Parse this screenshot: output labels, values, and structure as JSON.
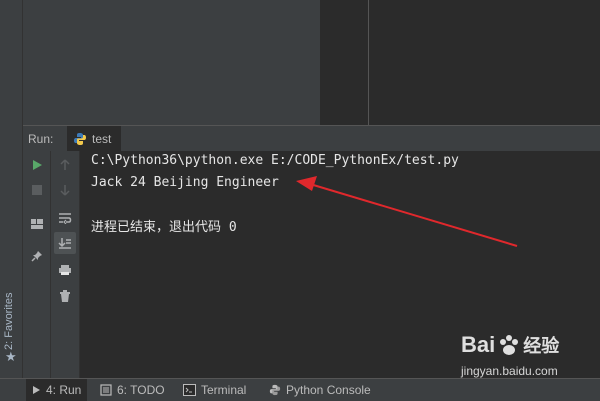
{
  "favorites": {
    "label": "2: Favorites",
    "icon": "star-icon"
  },
  "run_panel": {
    "header_label": "Run:",
    "tab_label": "test",
    "tab_icon": "python-icon"
  },
  "toolbar_primary": [
    "run-icon",
    "stop-icon",
    "layout-icon",
    "pin-icon"
  ],
  "toolbar_secondary": [
    "up-arrow-icon",
    "down-arrow-icon",
    "soft-wrap-icon",
    "scroll-to-end-icon",
    "print-icon",
    "trash-icon"
  ],
  "console": {
    "lines": [
      "C:\\Python36\\python.exe E:/CODE_PythonEx/test.py",
      "Jack 24 Beijing Engineer",
      "",
      "进程已结束，退出代码 0"
    ]
  },
  "status_bar": {
    "items": [
      {
        "label": "4: Run",
        "icon": "play-icon"
      },
      {
        "label": "6: TODO",
        "icon": "list-icon"
      },
      {
        "label": "Terminal",
        "icon": "terminal-icon"
      },
      {
        "label": "Python Console",
        "icon": "python-icon"
      }
    ]
  },
  "watermark": {
    "brand": "Bai",
    "brand2": "经验",
    "url": "jingyan.baidu.com"
  },
  "colors": {
    "annotation_arrow": "#e0282c",
    "run_green": "#59a869",
    "console_bg": "#2b2b2b",
    "panel_bg": "#3c3f41"
  }
}
